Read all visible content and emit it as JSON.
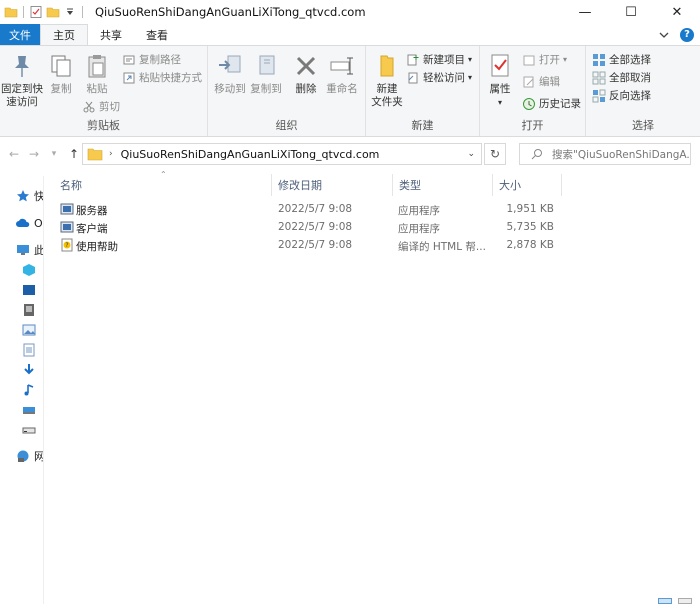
{
  "window": {
    "title": "QiuSuoRenShiDangAnGuanLiXiTong_qtvcd.com",
    "minimize": "—",
    "maximize": "☐",
    "close": "✕"
  },
  "tabs": [
    {
      "label": "文件"
    },
    {
      "label": "主页"
    },
    {
      "label": "共享"
    },
    {
      "label": "查看"
    }
  ],
  "ribbon": {
    "clipboard": {
      "label": "剪贴板",
      "pin": "固定到快\n速访问",
      "copy": "复制",
      "paste": "粘贴",
      "copy_path": "复制路径",
      "paste_shortcut": "粘贴快捷方式",
      "cut": "剪切"
    },
    "organize": {
      "label": "组织",
      "move_to": "移动到",
      "copy_to": "复制到",
      "delete": "删除",
      "rename": "重命名"
    },
    "new": {
      "label": "新建",
      "new_folder": "新建\n文件夹",
      "new_item": "新建项目",
      "easy_access": "轻松访问"
    },
    "open": {
      "label": "打开",
      "properties": "属性",
      "open": "打开",
      "edit": "编辑",
      "history": "历史记录"
    },
    "select": {
      "label": "选择",
      "select_all": "全部选择",
      "select_none": "全部取消",
      "invert": "反向选择"
    }
  },
  "address": {
    "path": "QiuSuoRenShiDangAnGuanLiXiTong_qtvcd.com",
    "search_placeholder": "搜索\"QiuSuoRenShiDangA..."
  },
  "columns": {
    "name": "名称",
    "modified": "修改日期",
    "type": "类型",
    "size": "大小"
  },
  "files": [
    {
      "name": "服务器",
      "modified": "2022/5/7 9:08",
      "type": "应用程序",
      "size": "1,951 KB",
      "icon": "app-icon"
    },
    {
      "name": "客户端",
      "modified": "2022/5/7 9:08",
      "type": "应用程序",
      "size": "5,735 KB",
      "icon": "app-icon"
    },
    {
      "name": "使用帮助",
      "modified": "2022/5/7 9:08",
      "type": "编译的 HTML 帮...",
      "size": "2,878 KB",
      "icon": "help-file-icon"
    }
  ],
  "nav": [
    {
      "label": "快",
      "icon": "star-icon"
    },
    {
      "label": "O",
      "icon": "cloud-icon"
    },
    {
      "label": "此",
      "icon": "computer-icon"
    },
    {
      "label": "",
      "icon": "3d-objects-icon"
    },
    {
      "label": "",
      "icon": "video-icon"
    },
    {
      "label": "",
      "icon": "pictures-icon"
    },
    {
      "label": "",
      "icon": "pictures-icon"
    },
    {
      "label": "",
      "icon": "documents-icon"
    },
    {
      "label": "",
      "icon": "downloads-icon"
    },
    {
      "label": "",
      "icon": "music-icon"
    },
    {
      "label": "",
      "icon": "desktop-icon"
    },
    {
      "label": "",
      "icon": "drive-icon"
    },
    {
      "label": "网",
      "icon": "network-icon"
    }
  ],
  "colors": {
    "accent": "#1979ca",
    "ribbon_bg": "#f5f6f7",
    "folder": "#f7c94c"
  }
}
